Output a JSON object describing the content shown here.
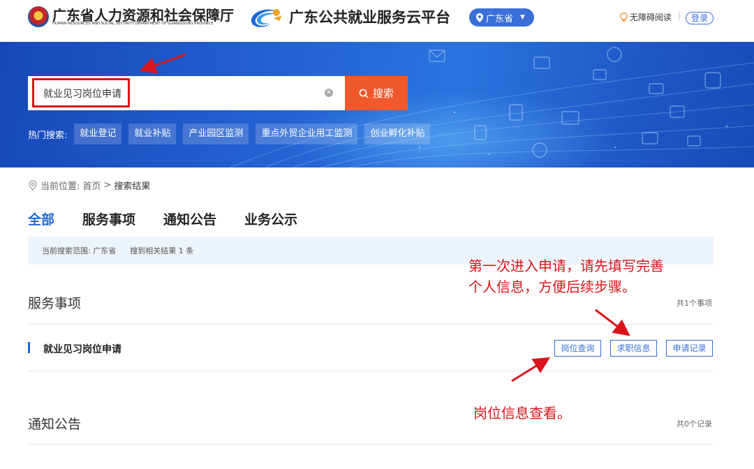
{
  "header": {
    "hr_title": "广东省人力资源和社会保障厅",
    "hr_subtitle": "HUMAN RESOURCES AND SOCIAL SECURITY DEPARTMENT OF GUANGDONG PROVINCE",
    "platform_title": "广东公共就业服务云平台",
    "region": "广东省",
    "accessibility": "无障碍阅读",
    "login": "登录"
  },
  "search": {
    "value": "就业见习岗位申请",
    "button": "搜索"
  },
  "hot_search": {
    "label": "热门搜索:",
    "tags": [
      "就业登记",
      "就业补贴",
      "产业园区监测",
      "重点外贸企业用工监测",
      "创业孵化补贴"
    ]
  },
  "breadcrumb": {
    "label": "当前位置:",
    "home": "首页",
    "separator": ">",
    "current": "搜索结果"
  },
  "tabs": [
    {
      "label": "全部",
      "active": true
    },
    {
      "label": "服务事项",
      "active": false
    },
    {
      "label": "通知公告",
      "active": false
    },
    {
      "label": "业务公示",
      "active": false
    }
  ],
  "scope": {
    "range": "当前搜索范围: 广东省",
    "result": "搜到相关结果 1 条"
  },
  "services": {
    "title": "服务事项",
    "count": "共1个事项",
    "item_title": "就业见习岗位申请",
    "actions": [
      "岗位查询",
      "求职信息",
      "申请记录"
    ]
  },
  "notices": {
    "title": "通知公告",
    "count": "共0个记录"
  },
  "annotations": {
    "note_line1": "第一次进入申请，请先填写完善",
    "note_line2": "个人信息，方便后续步骤。",
    "note_jobs": "岗位信息查看。"
  },
  "colors": {
    "primary": "#1f66d8",
    "search_button": "#f0592c",
    "annotation": "#d9151b"
  }
}
